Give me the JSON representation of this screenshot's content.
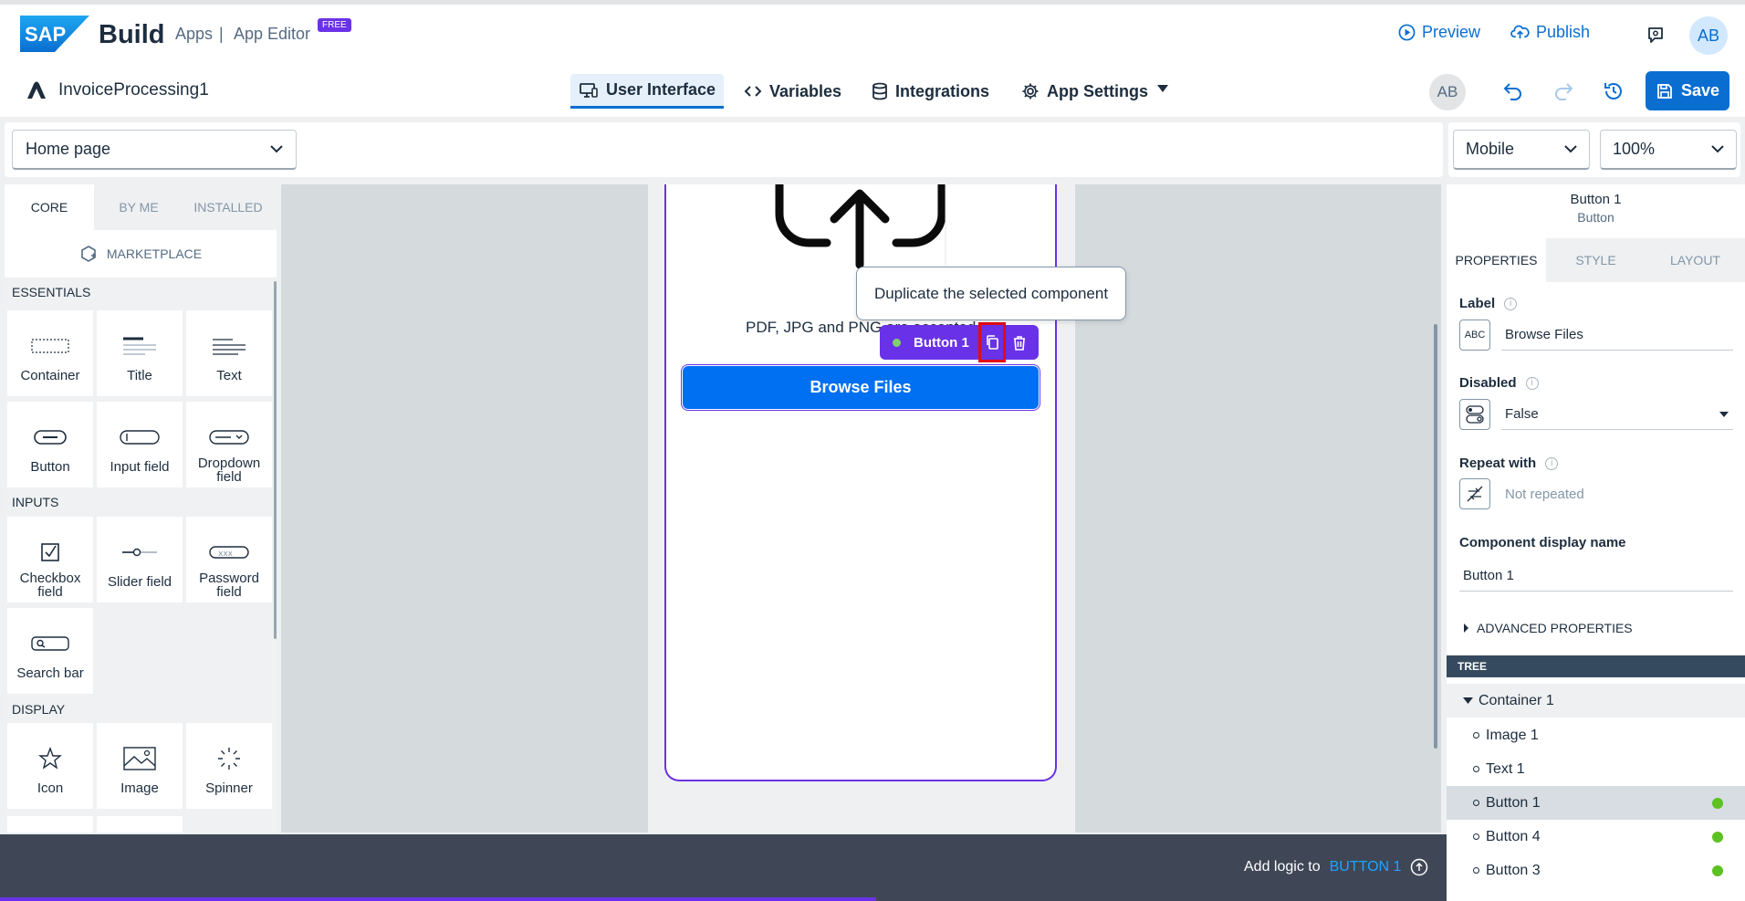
{
  "header": {
    "brand": "Build",
    "apps": "Apps",
    "separator": "|",
    "editor": "App Editor",
    "badge": "FREE",
    "preview": "Preview",
    "publish": "Publish",
    "user_initials": "AB"
  },
  "project": {
    "name": "InvoiceProcessing1",
    "tabs": {
      "ui": "User Interface",
      "variables": "Variables",
      "integrations": "Integrations",
      "settings": "App Settings"
    },
    "collaborator_initials": "AB",
    "save": "Save"
  },
  "toolbar": {
    "page": "Home page",
    "device": "Mobile",
    "zoom": "100%"
  },
  "library": {
    "tabs": [
      "CORE",
      "BY ME",
      "INSTALLED"
    ],
    "marketplace": "MARKETPLACE",
    "sections": {
      "essentials": "ESSENTIALS",
      "inputs": "INPUTS",
      "display": "DISPLAY"
    },
    "essentials": [
      "Container",
      "Title",
      "Text",
      "Button",
      "Input field",
      "Dropdown field"
    ],
    "inputs": [
      "Checkbox field",
      "Slider field",
      "Password field",
      "Search bar"
    ],
    "display": [
      "Icon",
      "Image",
      "Spinner"
    ]
  },
  "canvas": {
    "upload_note": "PDF, JPG and PNG are accepted",
    "browse_button": "Browse Files",
    "selected_chip": "Button 1",
    "tooltip": "Duplicate the selected component"
  },
  "properties": {
    "selected_name": "Button 1",
    "selected_type": "Button",
    "tabs": [
      "PROPERTIES",
      "STYLE",
      "LAYOUT"
    ],
    "label_title": "Label",
    "label_value": "Browse Files",
    "label_icon_text": "ABC",
    "disabled_title": "Disabled",
    "disabled_value": "False",
    "repeat_title": "Repeat with",
    "repeat_value": "Not repeated",
    "display_name_title": "Component display name",
    "display_name_value": "Button 1",
    "advanced": "ADVANCED PROPERTIES"
  },
  "tree": {
    "title": "TREE",
    "root": "Container 1",
    "items": [
      "Image 1",
      "Text 1",
      "Button 1",
      "Button 4",
      "Button 3"
    ]
  },
  "bottom": {
    "add_logic": "Add logic to",
    "target": "BUTTON 1"
  },
  "colors": {
    "accent": "#0a6ed1",
    "selection": "#6a32e8",
    "button": "#0070f2",
    "highlight": "#e30b17",
    "status_ok": "#5dc122"
  }
}
